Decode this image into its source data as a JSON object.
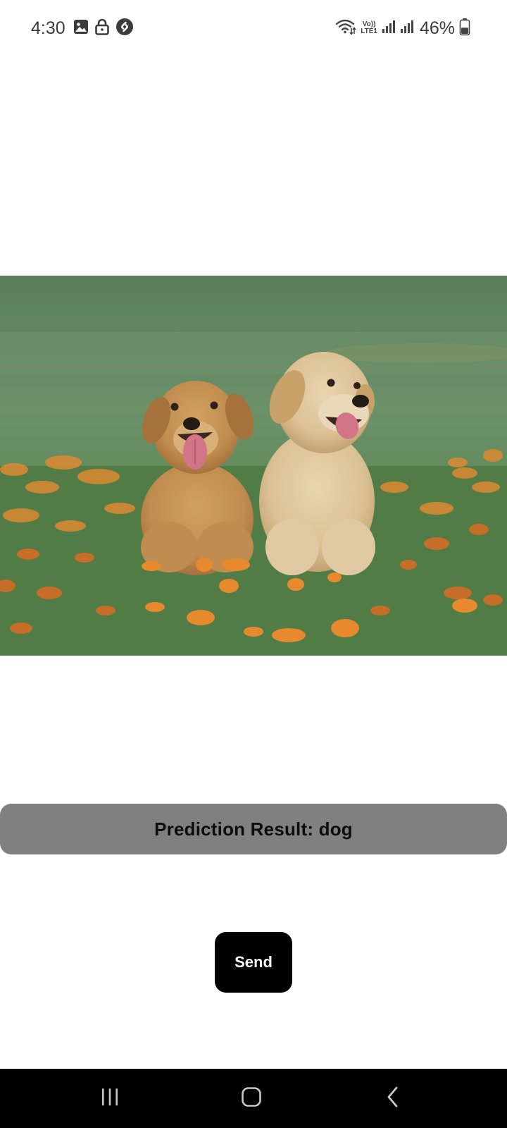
{
  "status_bar": {
    "time": "4:30",
    "battery_percent": "46%",
    "network_label_top": "Vo))",
    "network_label_bottom": "LTE1",
    "icons_left": [
      "gallery-icon",
      "lock-icon",
      "shazam-icon"
    ],
    "icons_right": [
      "wifi-icon",
      "volte-icon",
      "signal-icon",
      "signal-icon",
      "battery-icon"
    ],
    "battery_level": 0.46
  },
  "photo": {
    "subject": "two golden retriever puppies sitting in grass with orange flowers"
  },
  "prediction": {
    "text": "Prediction Result: dog"
  },
  "send_button": {
    "label": "Send"
  },
  "nav_bar": {
    "icons": [
      "recent-apps-icon",
      "home-icon",
      "back-icon"
    ]
  },
  "colors": {
    "prediction_bar_bg": "#808080",
    "send_button_bg": "#000000",
    "nav_bar_bg": "#000000",
    "page_bg": "#ffffff"
  }
}
